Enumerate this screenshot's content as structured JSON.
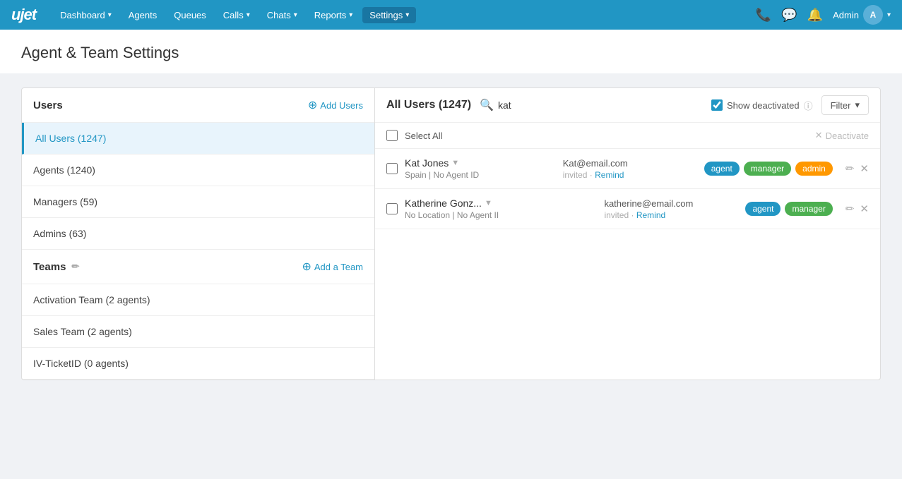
{
  "nav": {
    "logo": "ujet",
    "items": [
      {
        "label": "Dashboard",
        "hasChevron": true,
        "active": false
      },
      {
        "label": "Agents",
        "hasChevron": false,
        "active": false
      },
      {
        "label": "Queues",
        "hasChevron": false,
        "active": false
      },
      {
        "label": "Calls",
        "hasChevron": true,
        "active": false
      },
      {
        "label": "Chats",
        "hasChevron": true,
        "active": false
      },
      {
        "label": "Reports",
        "hasChevron": true,
        "active": false
      },
      {
        "label": "Settings",
        "hasChevron": true,
        "active": true
      }
    ],
    "admin_label": "Admin",
    "avatar_initials": "A"
  },
  "page": {
    "title": "Agent & Team Settings"
  },
  "left_panel": {
    "header": "Users",
    "add_users_label": "Add Users",
    "user_groups": [
      {
        "label": "All Users (1247)",
        "active": true
      },
      {
        "label": "Agents (1240)",
        "active": false
      },
      {
        "label": "Managers (59)",
        "active": false
      },
      {
        "label": "Admins (63)",
        "active": false
      }
    ],
    "teams_header": "Teams",
    "add_team_label": "Add a Team",
    "teams": [
      {
        "label": "Activation Team (2 agents)"
      },
      {
        "label": "Sales Team (2 agents)"
      },
      {
        "label": "IV-TicketID (0 agents)"
      }
    ]
  },
  "right_panel": {
    "title": "All Users (1247)",
    "search_placeholder": "kat",
    "show_deactivated_label": "Show deactivated",
    "filter_label": "Filter",
    "select_all_label": "Select All",
    "deactivate_label": "Deactivate",
    "users": [
      {
        "name": "Kat Jones",
        "chevron": "▼",
        "sub1": "Spain",
        "sub2": "No Agent ID",
        "email": "Kat@email.com",
        "status": "invited",
        "remind": "Remind",
        "tags": [
          "agent",
          "manager",
          "admin"
        ],
        "tag_colors": [
          "tag-agent",
          "tag-manager",
          "tag-admin"
        ]
      },
      {
        "name": "Katherine Gonz...",
        "chevron": "▼",
        "sub1": "No Location",
        "sub2": "No Agent II",
        "email": "katherine@email.com",
        "status": "invited",
        "remind": "Remind",
        "tags": [
          "agent",
          "manager"
        ],
        "tag_colors": [
          "tag-agent",
          "tag-manager"
        ]
      }
    ]
  }
}
